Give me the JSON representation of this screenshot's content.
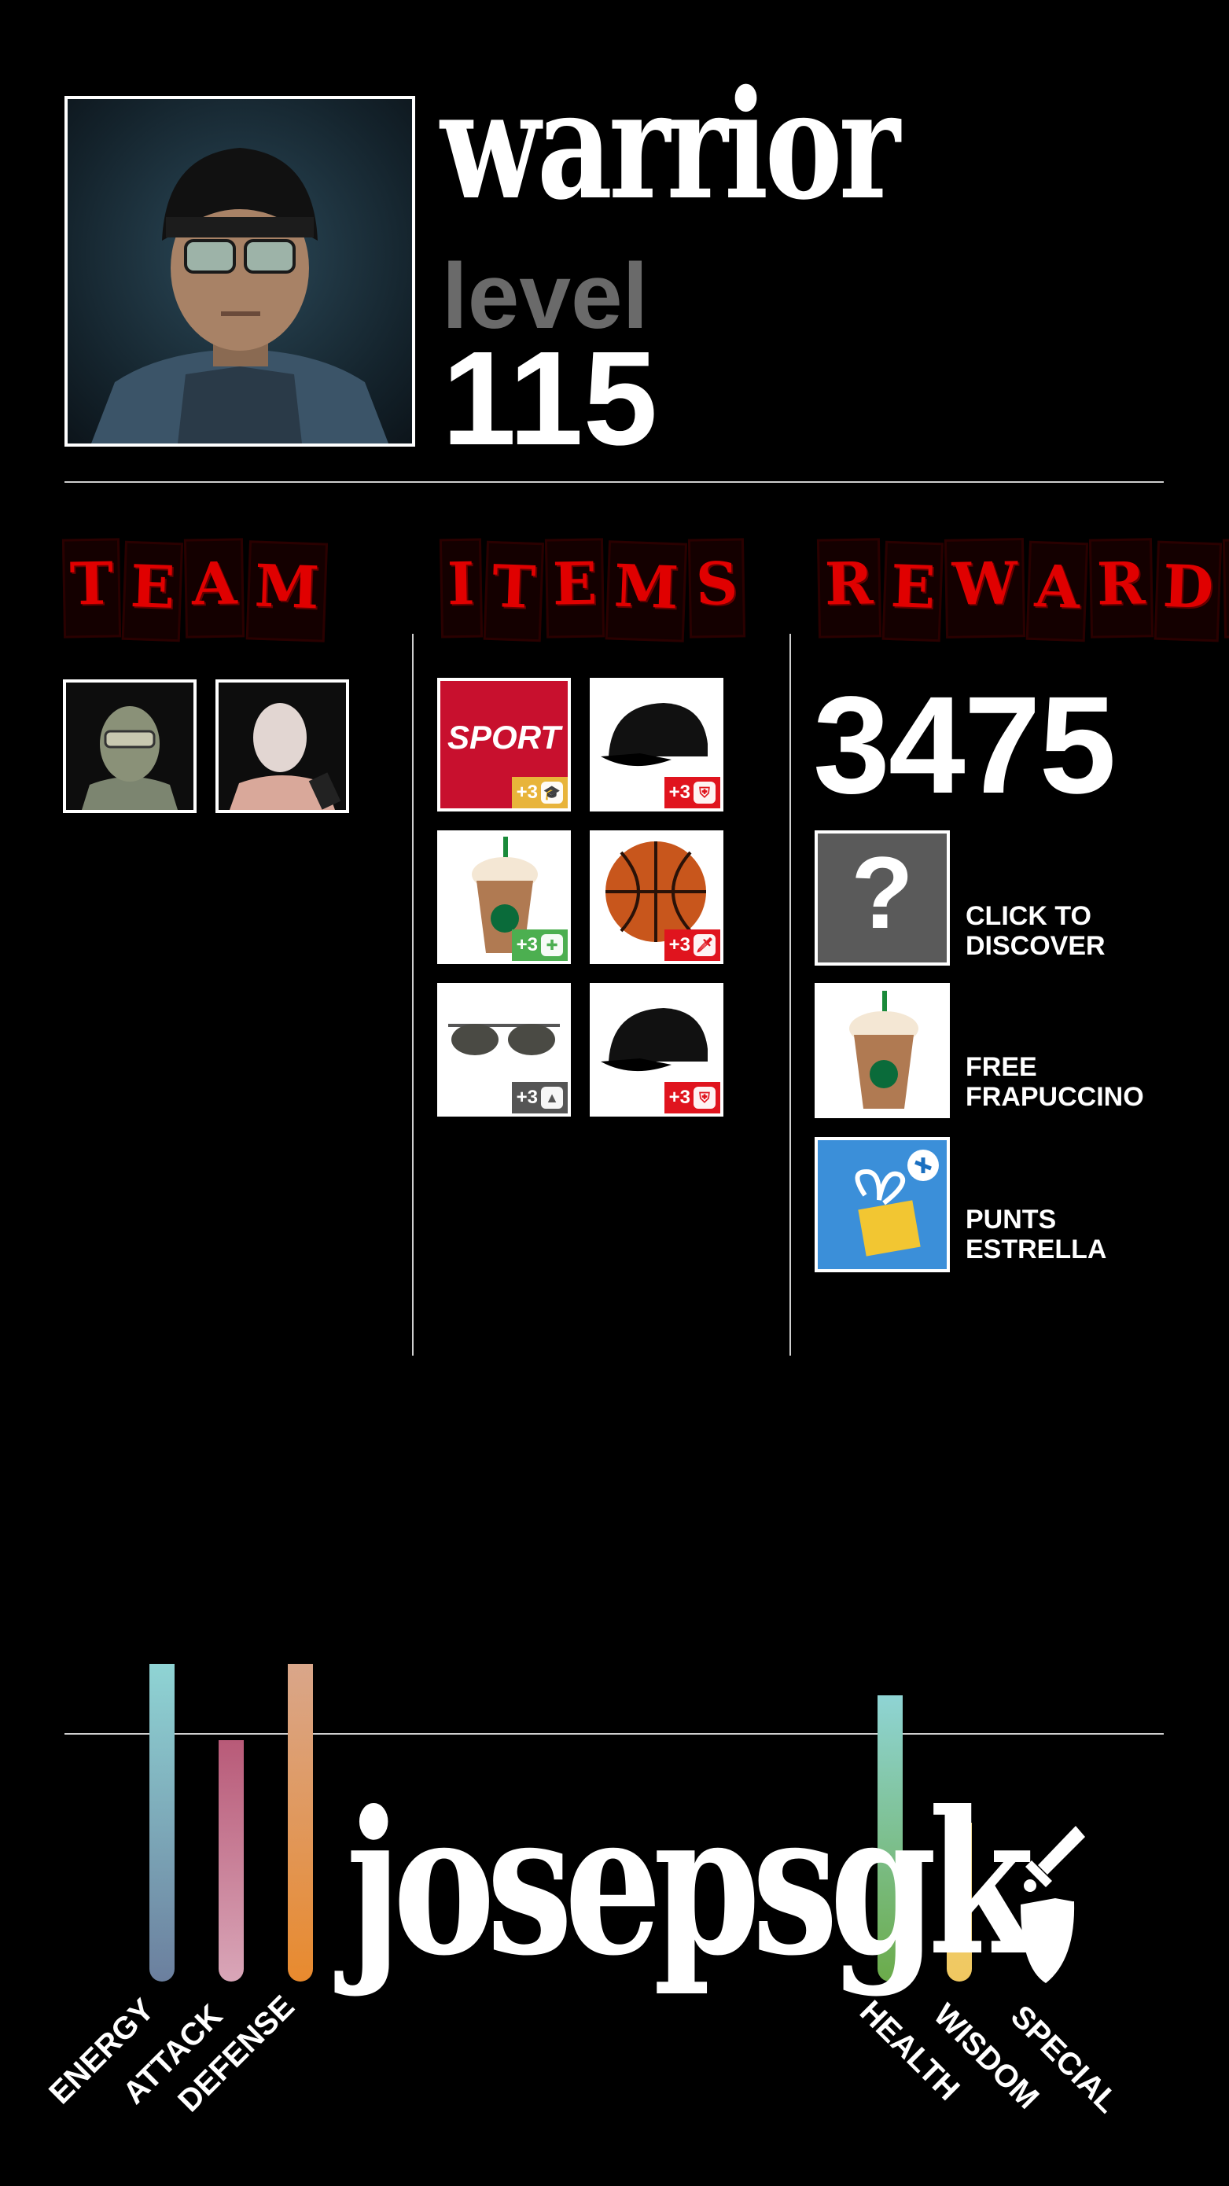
{
  "header": {
    "title": "warrior",
    "level_label": "level",
    "level_value": "115"
  },
  "sections": {
    "team": {
      "title": [
        "T",
        "E",
        "A",
        "M"
      ]
    },
    "items": {
      "title": [
        "I",
        "T",
        "E",
        "M",
        "S"
      ]
    },
    "rewards": {
      "title": [
        "R",
        "E",
        "W",
        "A",
        "R",
        "D",
        "S"
      ]
    }
  },
  "items": [
    {
      "name": "sport-newspaper",
      "bonus": "+3",
      "badge_color": "#e8b43a",
      "icon": "graduation-cap-icon",
      "icon_glyph": "🎓",
      "label": "SPORT"
    },
    {
      "name": "black-cap",
      "bonus": "+3",
      "badge_color": "#e0141e",
      "icon": "shield-icon",
      "icon_glyph": "⛨"
    },
    {
      "name": "frappuccino-cup",
      "bonus": "+3",
      "badge_color": "#4caf50",
      "icon": "first-aid-icon",
      "icon_glyph": "✚"
    },
    {
      "name": "basketball",
      "bonus": "+3",
      "badge_color": "#e0141e",
      "icon": "sword-icon",
      "icon_glyph": "🗡"
    },
    {
      "name": "sunglasses",
      "bonus": "+3",
      "badge_color": "#555555",
      "icon": "up-arrow-icon",
      "icon_glyph": "▲"
    },
    {
      "name": "black-cap",
      "bonus": "+3",
      "badge_color": "#e0141e",
      "icon": "shield-icon",
      "icon_glyph": "⛨"
    }
  ],
  "rewards": {
    "points": "3475",
    "list": [
      {
        "label_line1": "CLICK TO",
        "label_line2": "DISCOVER",
        "tile_glyph": "?"
      },
      {
        "label_line1": "FREE",
        "label_line2": "FRAPUCCINO"
      },
      {
        "label_line1": "PUNTS",
        "label_line2": "ESTRELLA"
      }
    ]
  },
  "username": "josepsgk",
  "stats": [
    {
      "label": "ENERGY",
      "level": 1.0,
      "color_top": "#8fd4d4",
      "color_bottom": "#6b7f9e"
    },
    {
      "label": "ATTACK",
      "level": 0.76,
      "color_top": "#b85a78",
      "color_bottom": "#d9a6b8"
    },
    {
      "label": "DEFENSE",
      "level": 1.0,
      "color_top": "#d9a68a",
      "color_bottom": "#e88a2e"
    },
    {
      "label": "HEALTH",
      "level": 0.9,
      "color_top": "#8fd4d4",
      "color_bottom": "#6bab4a"
    },
    {
      "label": "WISDOM",
      "level": 0.5,
      "color_top": "#f0d27a",
      "color_bottom": "#f0c860"
    },
    {
      "label": "SPECIAL",
      "level": 0.5,
      "icon": "sword-shield-icon"
    }
  ]
}
